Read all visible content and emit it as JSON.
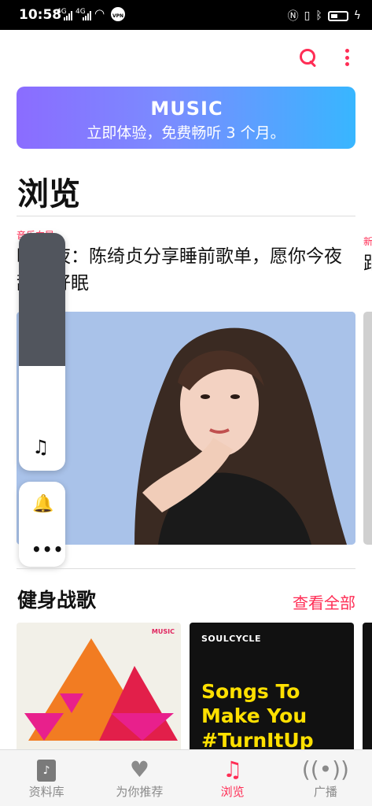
{
  "status_bar": {
    "time": "10:58",
    "net1": "4G",
    "net2": "4G",
    "vpn": "VPN"
  },
  "banner": {
    "brand": "MUSIC",
    "subtitle": "立即体验，免费畅听 3 个月。"
  },
  "page": {
    "title": "浏览"
  },
  "feature": {
    "tag": "音乐向导",
    "headline": "晚安夜：陈绮贞分享睡前歌单，愿你今夜甜梦好眠",
    "peek_tag": "新",
    "peek_text": "距"
  },
  "volume_panel": {
    "level": 0.44
  },
  "section": {
    "title": "健身战歌",
    "see_all": "查看全部"
  },
  "cards": [
    {
      "logo": "MUSIC"
    },
    {
      "brand": "SOULCYCLE",
      "lines": [
        "Songs To",
        "Make You",
        "#TurnItUp"
      ]
    }
  ],
  "tabs": [
    {
      "label": "资料库",
      "icon": "library-icon"
    },
    {
      "label": "为你推荐",
      "icon": "heart-icon"
    },
    {
      "label": "浏览",
      "icon": "music-note-icon",
      "active": true
    },
    {
      "label": "广播",
      "icon": "radio-icon"
    }
  ],
  "colors": {
    "accent": "#ff2d55"
  }
}
